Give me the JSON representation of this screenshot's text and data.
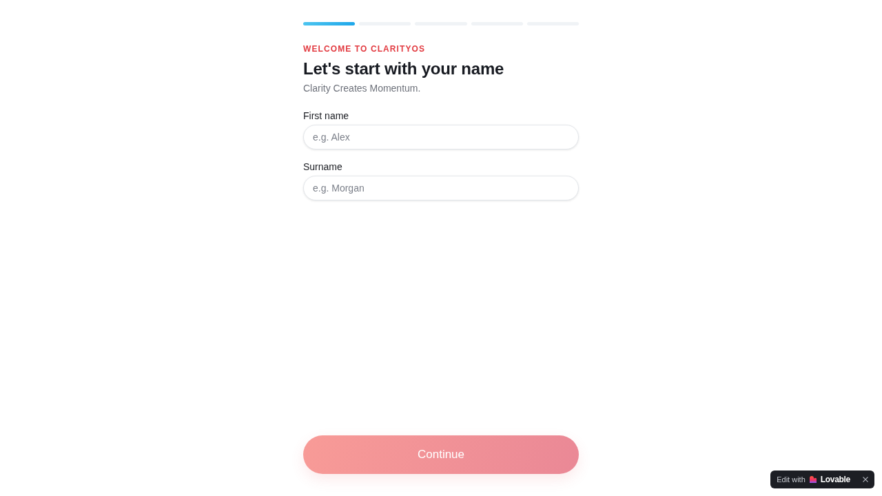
{
  "progress": {
    "steps": [
      {
        "complete": true
      },
      {
        "complete": false
      },
      {
        "complete": false
      },
      {
        "complete": false
      },
      {
        "complete": false
      }
    ]
  },
  "eyebrow": "WELCOME TO CLARITYOS",
  "heading": "Let's start with your name",
  "subtitle": "Clarity Creates Momentum.",
  "fields": [
    {
      "label": "First name",
      "placeholder": "e.g. Alex"
    },
    {
      "label": "Surname",
      "placeholder": "e.g. Morgan"
    }
  ],
  "continue_button": {
    "label": "Continue",
    "disabled": true
  },
  "badge": {
    "prefix": "Edit with",
    "brand": "Lovable"
  }
}
